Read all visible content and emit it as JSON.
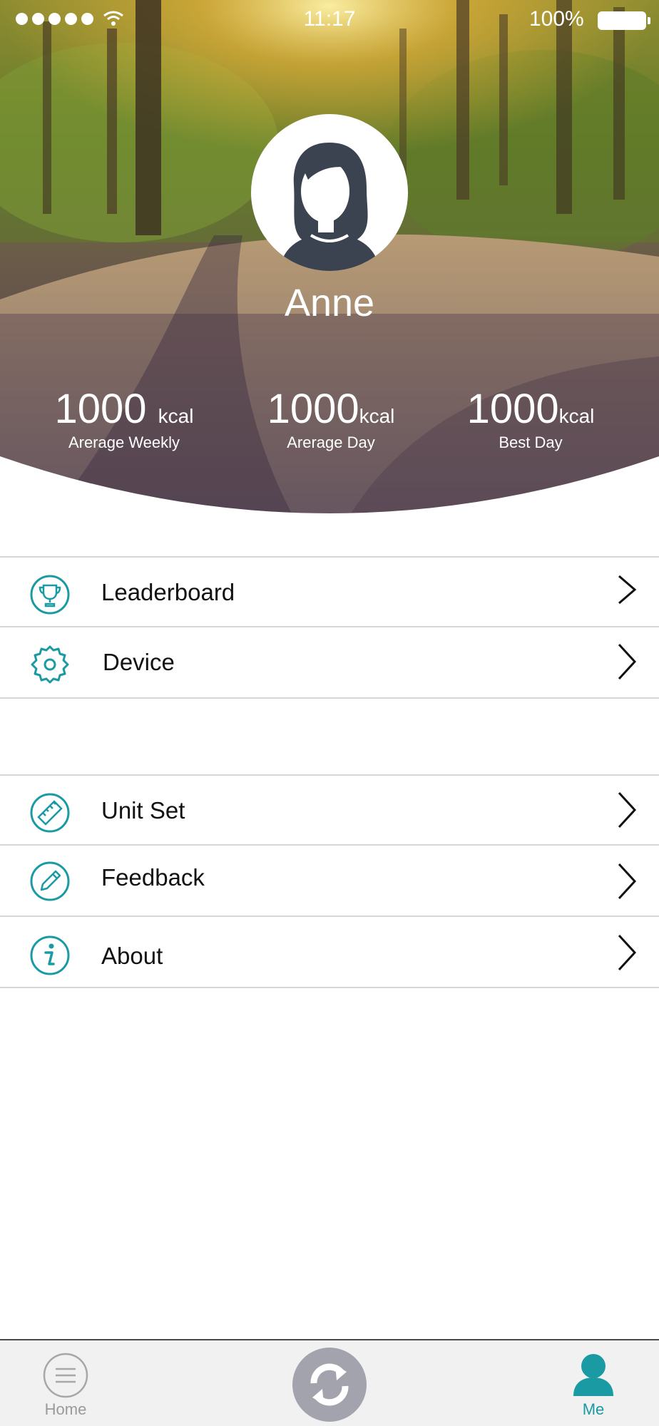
{
  "status_bar": {
    "time": "11:17",
    "battery": "100%"
  },
  "profile": {
    "name": "Anne",
    "stats": [
      {
        "value": "1000",
        "unit": "kcal",
        "label": "Arerage Weekly"
      },
      {
        "value": "1000",
        "unit": "kcal",
        "label": "Arerage Day"
      },
      {
        "value": "1000",
        "unit": "kcal",
        "label": "Best Day"
      }
    ]
  },
  "menu": {
    "group1": [
      {
        "label": "Leaderboard",
        "icon": "trophy-icon"
      },
      {
        "label": "Device",
        "icon": "gear-icon"
      }
    ],
    "group2": [
      {
        "label": "Unit Set",
        "icon": "ruler-icon"
      },
      {
        "label": "Feedback",
        "icon": "pencil-icon"
      },
      {
        "label": "About",
        "icon": "info-icon"
      }
    ]
  },
  "tabbar": {
    "home": "Home",
    "me": "Me"
  },
  "colors": {
    "accent": "#1a9aa3",
    "avatar_dark": "#3c4350",
    "inactive": "#9a9a9a"
  }
}
